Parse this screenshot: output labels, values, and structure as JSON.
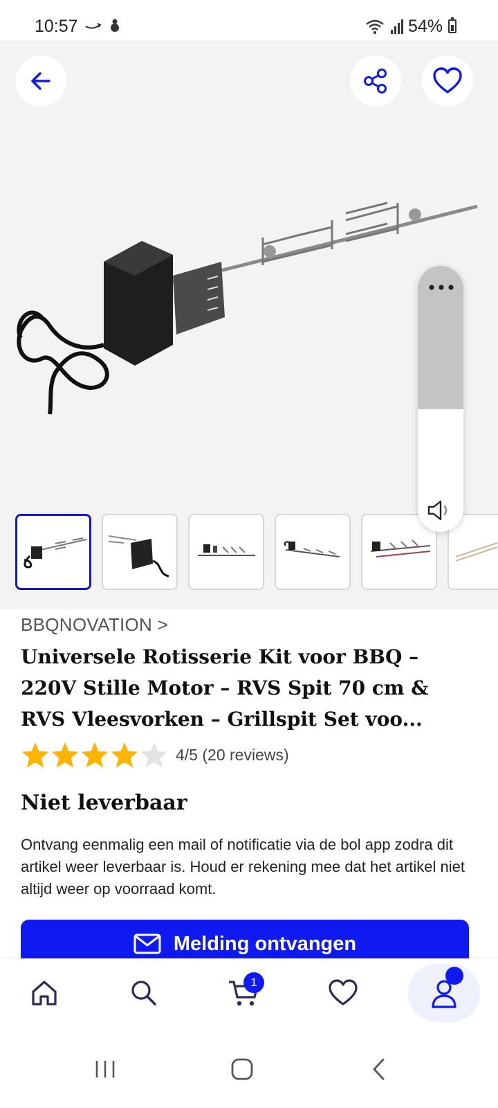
{
  "status_bar": {
    "time": "10:57",
    "battery": "54%"
  },
  "gallery": {
    "thumbnail_count": 6,
    "active_index": 0
  },
  "volume_overlay": {
    "level_fraction": 0.46
  },
  "product": {
    "brand": "BBQNOVATION >",
    "title": "Universele Rotisserie Kit voor BBQ – 220V Stille Motor – RVS Spit 70 cm & RVS Vleesvorken – Grillspit Set voo...",
    "rating": 4,
    "rating_max": 5,
    "rating_text": "4/5 (20 reviews)"
  },
  "availability": {
    "status": "Niet leverbaar",
    "description": "Ontvang eenmalig een mail of notificatie via de bol app zodra dit artikel weer leverbaar is. Houd er rekening mee dat het artikel niet altijd weer op voorraad komt.",
    "button_label": "Melding ontvangen"
  },
  "bottom_nav": {
    "items": [
      {
        "icon": "home-icon"
      },
      {
        "icon": "search-icon"
      },
      {
        "icon": "cart-icon"
      },
      {
        "icon": "heart-icon"
      },
      {
        "icon": "account-icon"
      }
    ],
    "cart_badge": "1"
  },
  "colors": {
    "accent": "#0e1af0",
    "star": "#ffb400",
    "star_empty": "#e3e3e3"
  }
}
